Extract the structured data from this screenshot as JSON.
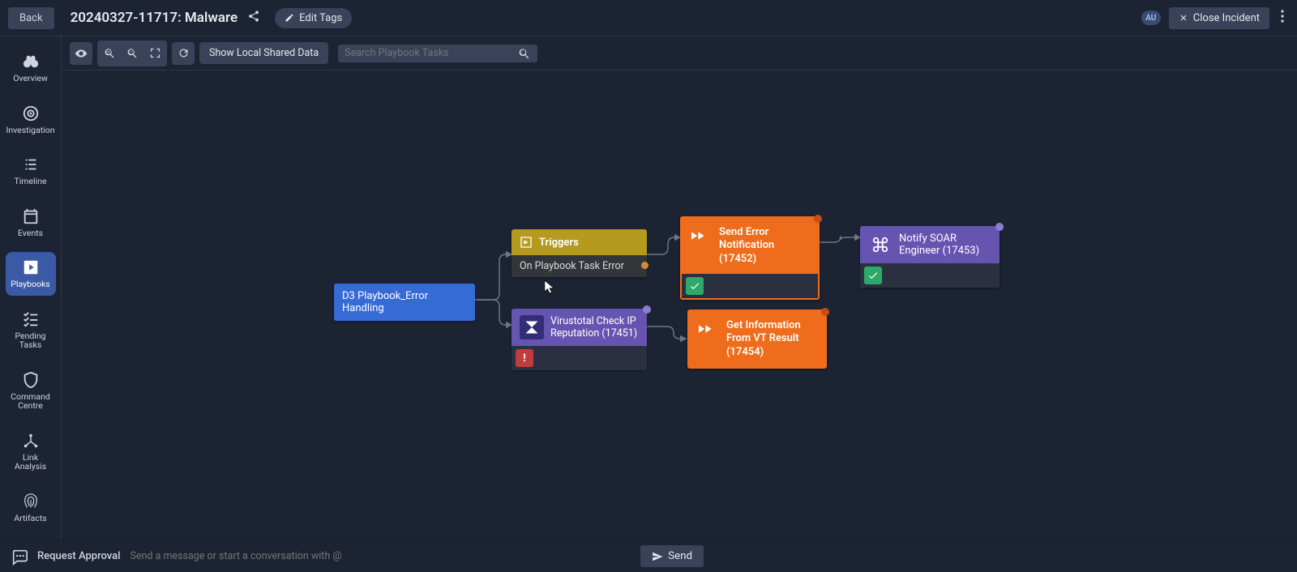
{
  "header": {
    "back": "Back",
    "title": "20240327-11717: Malware",
    "edit_tags": "Edit Tags",
    "avatar": "AU",
    "close_incident": "Close Incident"
  },
  "sidebar": {
    "overview": "Overview",
    "investigation": "Investigation",
    "timeline": "Timeline",
    "events": "Events",
    "playbooks": "Playbooks",
    "pending_tasks": "Pending Tasks",
    "command_centre": "Command Centre",
    "link_analysis": "Link Analysis",
    "artifacts": "Artifacts"
  },
  "toolbar": {
    "show_local": "Show Local Shared Data",
    "search_placeholder": "Search Playbook Tasks"
  },
  "pb_title": "D3 Playbook_Error Handling",
  "nodes": {
    "root": "D3 Playbook_Error Handling",
    "triggers_label": "Triggers",
    "triggers_body": "On Playbook Task Error",
    "send_error": "Send Error Notification (17452)",
    "notify_soar": "Notify SOAR Engineer (17453)",
    "vt_check": "Virustotal Check IP Reputation (17451)",
    "vt_result": "Get Information From VT Result (17454)",
    "err_mark": "!"
  },
  "footer": {
    "request_approval": "Request Approval",
    "placeholder": "Send a message or start a conversation with @",
    "send": "Send"
  }
}
